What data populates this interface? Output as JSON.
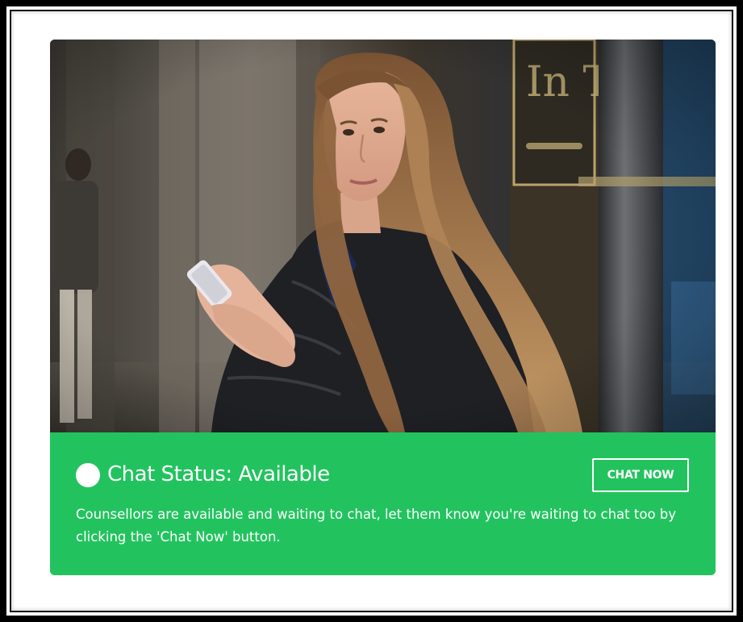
{
  "card": {
    "photo_alt": "Teenage girl holding a smartphone on a city street",
    "status_title": "Chat Status: Available",
    "button_label": "CHAT NOW",
    "description": "Counsellors are available and waiting to chat, let them know you're waiting to chat too by clicking the 'Chat Now' button.",
    "status": "available",
    "status_icon": "available-dot-icon"
  },
  "colors": {
    "accent": "#22c35e",
    "text": "#ffffff",
    "frame": "#000000"
  }
}
